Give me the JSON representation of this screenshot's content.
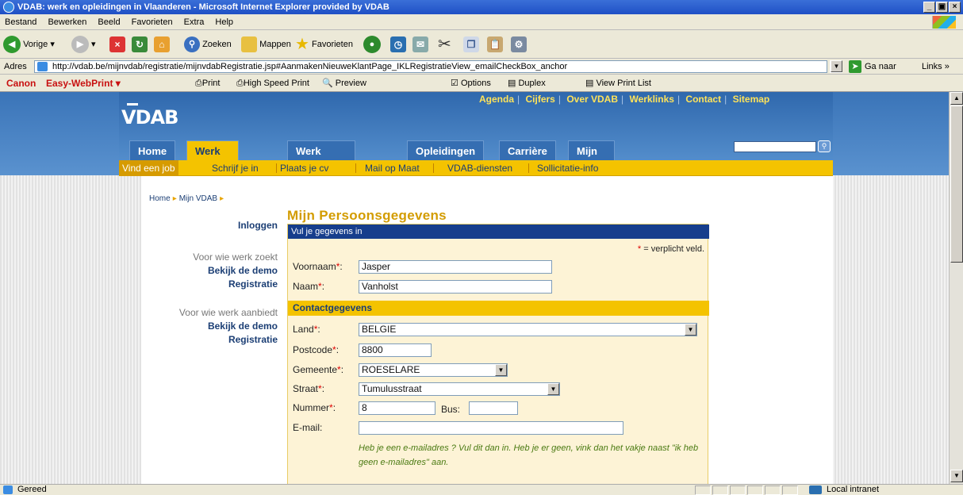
{
  "window": {
    "title": "VDAB: werk en opleidingen in Vlaanderen - Microsoft Internet Explorer provided by VDAB"
  },
  "menu": [
    "Bestand",
    "Bewerken",
    "Beeld",
    "Favorieten",
    "Extra",
    "Help"
  ],
  "toolbar": {
    "back": "Vorige",
    "search": "Zoeken",
    "folders": "Mappen",
    "favorites": "Favorieten"
  },
  "address": {
    "label": "Adres",
    "url": "http://vdab.be/mijnvdab/registratie/mijnvdabRegistratie.jsp#AanmakenNieuweKlantPage_IKLRegistratieView_emailCheckBox_anchor",
    "go": "Ga naar",
    "links": "Links"
  },
  "canon": {
    "brand": "Canon",
    "product": "Easy-WebPrint",
    "print": "Print",
    "hsprint": "High Speed Print",
    "preview": "Preview",
    "options": "Options",
    "duplex": "Duplex",
    "viewlist": "View Print List"
  },
  "site": {
    "logo": "VDAB",
    "toplinks": [
      "Agenda",
      "Cijfers",
      "Over VDAB",
      "Werklinks",
      "Contact",
      "Sitemap"
    ],
    "tabs": [
      "Home",
      "Werk zoeken",
      "Werk aanbieden",
      "Opleidingen",
      "Carrière",
      "Mijn VDAB"
    ],
    "subtabs": [
      "Vind een job",
      "Schrijf je in",
      "Plaats je cv",
      "Mail op Maat",
      "VDAB-diensten",
      "Sollicitatie-info"
    ]
  },
  "breadcrumb": [
    "Home",
    "Mijn VDAB"
  ],
  "left": {
    "login": "Inloggen",
    "seeker": "Voor wie werk zoekt",
    "demo1": "Bekijk de demo",
    "reg1": "Registratie",
    "offer": "Voor wie werk aanbiedt",
    "demo2": "Bekijk de demo",
    "reg2": "Registratie"
  },
  "form": {
    "title": "Mijn Persoonsgegevens",
    "header": "Vul je gegevens in",
    "required_note": "= verplicht veld.",
    "voornaam_label": "Voornaam",
    "voornaam": "Jasper",
    "naam_label": "Naam",
    "naam": "Vanholst",
    "contact_header": "Contactgegevens",
    "land_label": "Land",
    "land": "BELGIE",
    "postcode_label": "Postcode",
    "postcode": "8800",
    "gemeente_label": "Gemeente",
    "gemeente": "ROESELARE",
    "straat_label": "Straat",
    "straat": "Tumulusstraat",
    "nummer_label": "Nummer",
    "nummer": "8",
    "bus_label": "Bus:",
    "bus": "",
    "email_label": "E-mail:",
    "email": "",
    "email_note": "Heb je een e-mailadres ? Vul dit dan in. Heb je er geen, vink dan het vakje naast \"ik heb geen e-mailadres\" aan."
  },
  "status": {
    "left": "Gereed",
    "zone": "Local intranet"
  }
}
